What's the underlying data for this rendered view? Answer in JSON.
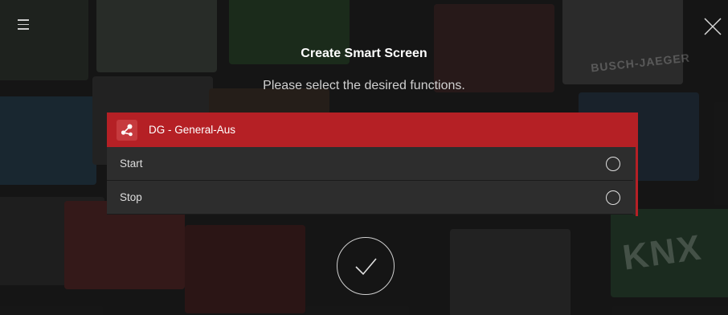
{
  "header": {
    "title": "Create Smart Screen",
    "subtitle": "Please select the desired functions."
  },
  "background": {
    "brand_text": "BUSCH-JAEGER",
    "knx_text": "KNX"
  },
  "group": {
    "label": "DG - General-Aus",
    "icon": "share-scene-icon"
  },
  "functions": [
    {
      "label": "Start",
      "selected": false
    },
    {
      "label": "Stop",
      "selected": false
    }
  ],
  "colors": {
    "accent": "#b52025",
    "background": "#1a1a1a",
    "list_bg": "#2d2d2d"
  }
}
